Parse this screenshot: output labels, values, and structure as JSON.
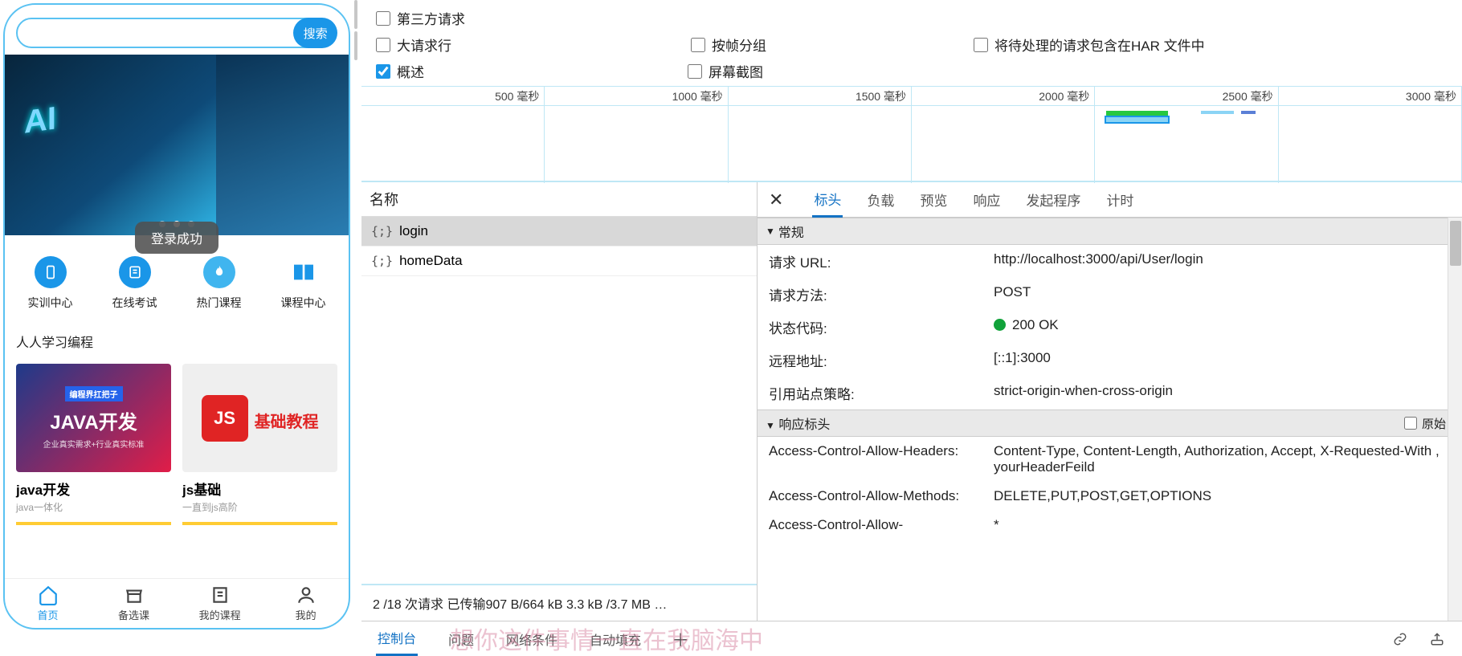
{
  "mobile": {
    "search_placeholder": "",
    "search_btn": "搜索",
    "toast": "登录成功",
    "nav": [
      {
        "label": "实训中心"
      },
      {
        "label": "在线考试"
      },
      {
        "label": "热门课程"
      },
      {
        "label": "课程中心"
      }
    ],
    "section_title": "人人学习编程",
    "cards": [
      {
        "img_tag": "编程界扛把子",
        "img_title": "JAVA开发",
        "img_sub": "企业真实需求+行业真实标准",
        "title": "java开发",
        "sub": "java一体化"
      },
      {
        "img_title": "JS",
        "img_side": "基础教程",
        "title": "js基础",
        "sub": "一直到js高阶"
      }
    ],
    "tabs": [
      {
        "label": "首页"
      },
      {
        "label": "备选课"
      },
      {
        "label": "我的课程"
      },
      {
        "label": "我的"
      }
    ]
  },
  "filters": {
    "third_party": "第三方请求",
    "big_rows": "大请求行",
    "group_by_frame": "按帧分组",
    "include_har": "将待处理的请求包含在HAR 文件中",
    "overview": "概述",
    "screenshot": "屏幕截图"
  },
  "timeline_ticks": [
    "500 毫秒",
    "1000 毫秒",
    "1500 毫秒",
    "2000 毫秒",
    "2500 毫秒",
    "3000 毫秒"
  ],
  "reqlist": {
    "header": "名称",
    "rows": [
      {
        "name": "login",
        "selected": true
      },
      {
        "name": "homeData",
        "selected": false
      }
    ],
    "status": "2 /18 次请求  已传输907 B/664 kB  3.3 kB /3.7 MB …"
  },
  "detail_tabs": [
    "标头",
    "负载",
    "预览",
    "响应",
    "发起程序",
    "计时"
  ],
  "sections": {
    "general": "常规",
    "response_headers": "响应标头",
    "raw": "原始"
  },
  "general": [
    {
      "k": "请求 URL:",
      "v": "http://localhost:3000/api/User/login"
    },
    {
      "k": "请求方法:",
      "v": "POST"
    },
    {
      "k": "状态代码:",
      "v": "200 OK",
      "status": true
    },
    {
      "k": "远程地址:",
      "v": "[::1]:3000"
    },
    {
      "k": "引用站点策略:",
      "v": "strict-origin-when-cross-origin"
    }
  ],
  "response_headers": [
    {
      "k": "Access-Control-Allow-Headers:",
      "v": "Content-Type, Content-Length, Authorization, Accept, X-Requested-With , yourHeaderFeild"
    },
    {
      "k": "Access-Control-Allow-Methods:",
      "v": "DELETE,PUT,POST,GET,OPTIONS"
    },
    {
      "k": "Access-Control-Allow-",
      "v": "*"
    }
  ],
  "bottom_tabs": [
    "控制台",
    "问题",
    "网络条件",
    "自动填充"
  ],
  "watermark": "想你这件事情一直在我脑海中"
}
